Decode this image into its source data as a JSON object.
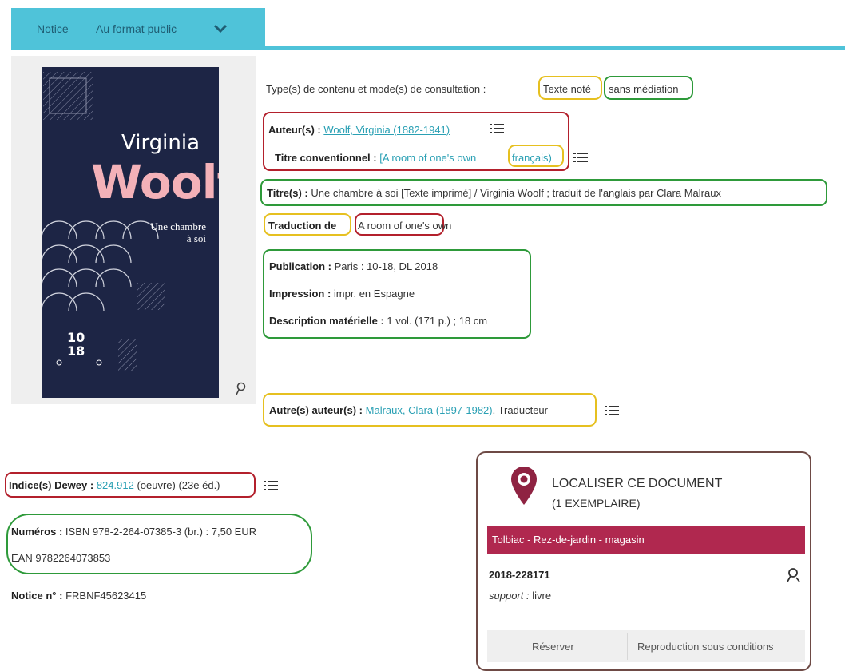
{
  "tabs": {
    "notice": "Notice",
    "format": "Au format public"
  },
  "cover": {
    "author_first": "Virginia",
    "author_last": "Woolf",
    "title_line1": "Une chambre",
    "title_line2": "à soi",
    "publisher_line1": "10",
    "publisher_line2": "18"
  },
  "fields": {
    "type_label": "Type(s) de contenu et mode(s) de consultation :",
    "type_value1": "Texte noté",
    "type_value2": "sans médiation",
    "author_label": "Auteur(s) :",
    "author_value": "Woolf, Virginia (1882-1941)",
    "conv_title_label": "Titre conventionnel :",
    "conv_title_value": "[A room of one's own",
    "conv_title_lang": "français)",
    "titles_label": "Titre(s) :",
    "titles_value": "Une chambre à soi [Texte imprimé] / Virginia Woolf ; traduit de l'anglais par Clara Malraux",
    "translation_label": "Traduction de",
    "translation_value": "A room of one's own",
    "publication_label": "Publication :",
    "publication_value": "Paris : 10-18, DL 2018",
    "printing_label": "Impression :",
    "printing_value": "impr. en Espagne",
    "description_label": "Description matérielle :",
    "description_value": "1 vol. (171 p.) ; 18 cm",
    "other_authors_label": "Autre(s) auteur(s) :",
    "other_authors_link": "Malraux, Clara (1897-1982)",
    "other_authors_role": ". Traducteur",
    "dewey_label": "Indice(s) Dewey :",
    "dewey_link": "824.912",
    "dewey_rest": "(oeuvre) (23e éd.)",
    "numbers_label": "Numéros :",
    "numbers_value": "ISBN 978-2-264-07385-3 (br.) : 7,50 EUR",
    "ean_value": "EAN 9782264073853",
    "notice_label": "Notice n° :",
    "notice_value": "FRBNF45623415"
  },
  "location": {
    "title": "LOCALISER CE DOCUMENT",
    "subtitle": "(1 EXEMPLAIRE)",
    "site": "Tolbiac - Rez-de-jardin - magasin",
    "call_number": "2018-228171",
    "support_label": "support :",
    "support_value": "livre",
    "reserve_button": "Réserver",
    "reproduction_button": "Reproduction sous conditions"
  },
  "colors": {
    "tab_bar": "#4fc3d9",
    "link": "#2aa0b4",
    "location_band": "#b0284f",
    "cover_bg": "#1d2545",
    "cover_author": "#f3b1b8",
    "highlight_red": "#b3202c",
    "highlight_yellow": "#e6c020",
    "highlight_green": "#2e9a3a"
  }
}
